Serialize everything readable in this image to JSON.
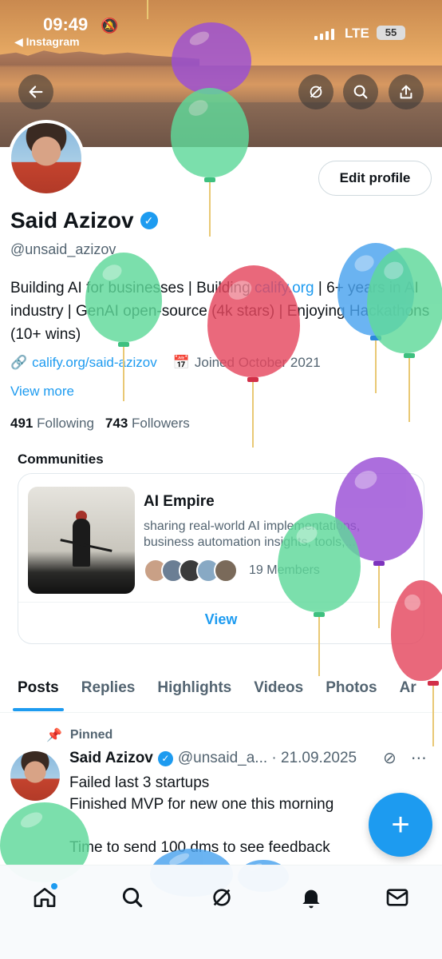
{
  "status_bar": {
    "time": "09:49",
    "back_app": "◀ Instagram",
    "network": "LTE",
    "battery": "55"
  },
  "profile": {
    "name": "Said Azizov",
    "handle": "@unsaid_azizov",
    "bio_parts": [
      {
        "text": "Building AI for businesses | Building ",
        "link": false
      },
      {
        "text": "calify.org",
        "link": true
      },
      {
        "text": " | 6+ years in AI industry | GenAI open-source (4k stars) | Enjoying Hackathons (10+ wins)",
        "link": false
      }
    ],
    "website": "calify.org/said-azizov",
    "joined": "Joined October 2021",
    "view_more": "View more",
    "following_count": "491",
    "following_label": "Following",
    "followers_count": "743",
    "followers_label": "Followers",
    "edit_label": "Edit profile"
  },
  "communities": {
    "title": "Communities",
    "name": "AI Empire",
    "description": "sharing real-world AI implementations, business automation insights, tools,...",
    "members": "19 Members",
    "view_label": "View"
  },
  "tabs": [
    "Posts",
    "Replies",
    "Highlights",
    "Videos",
    "Photos",
    "Ar"
  ],
  "post": {
    "pinned_label": "Pinned",
    "author": "Said Azizov",
    "handle_date": "@unsaid_a... · 21.09.2025",
    "text": "Failed last 3 startups\nFinished MVP for new one this morning\n\nTime to send 100 dms to see feedback"
  },
  "fab_label": "+",
  "colors": {
    "accent": "#1d9bf0",
    "text": "#0f1419",
    "muted": "#536471"
  }
}
